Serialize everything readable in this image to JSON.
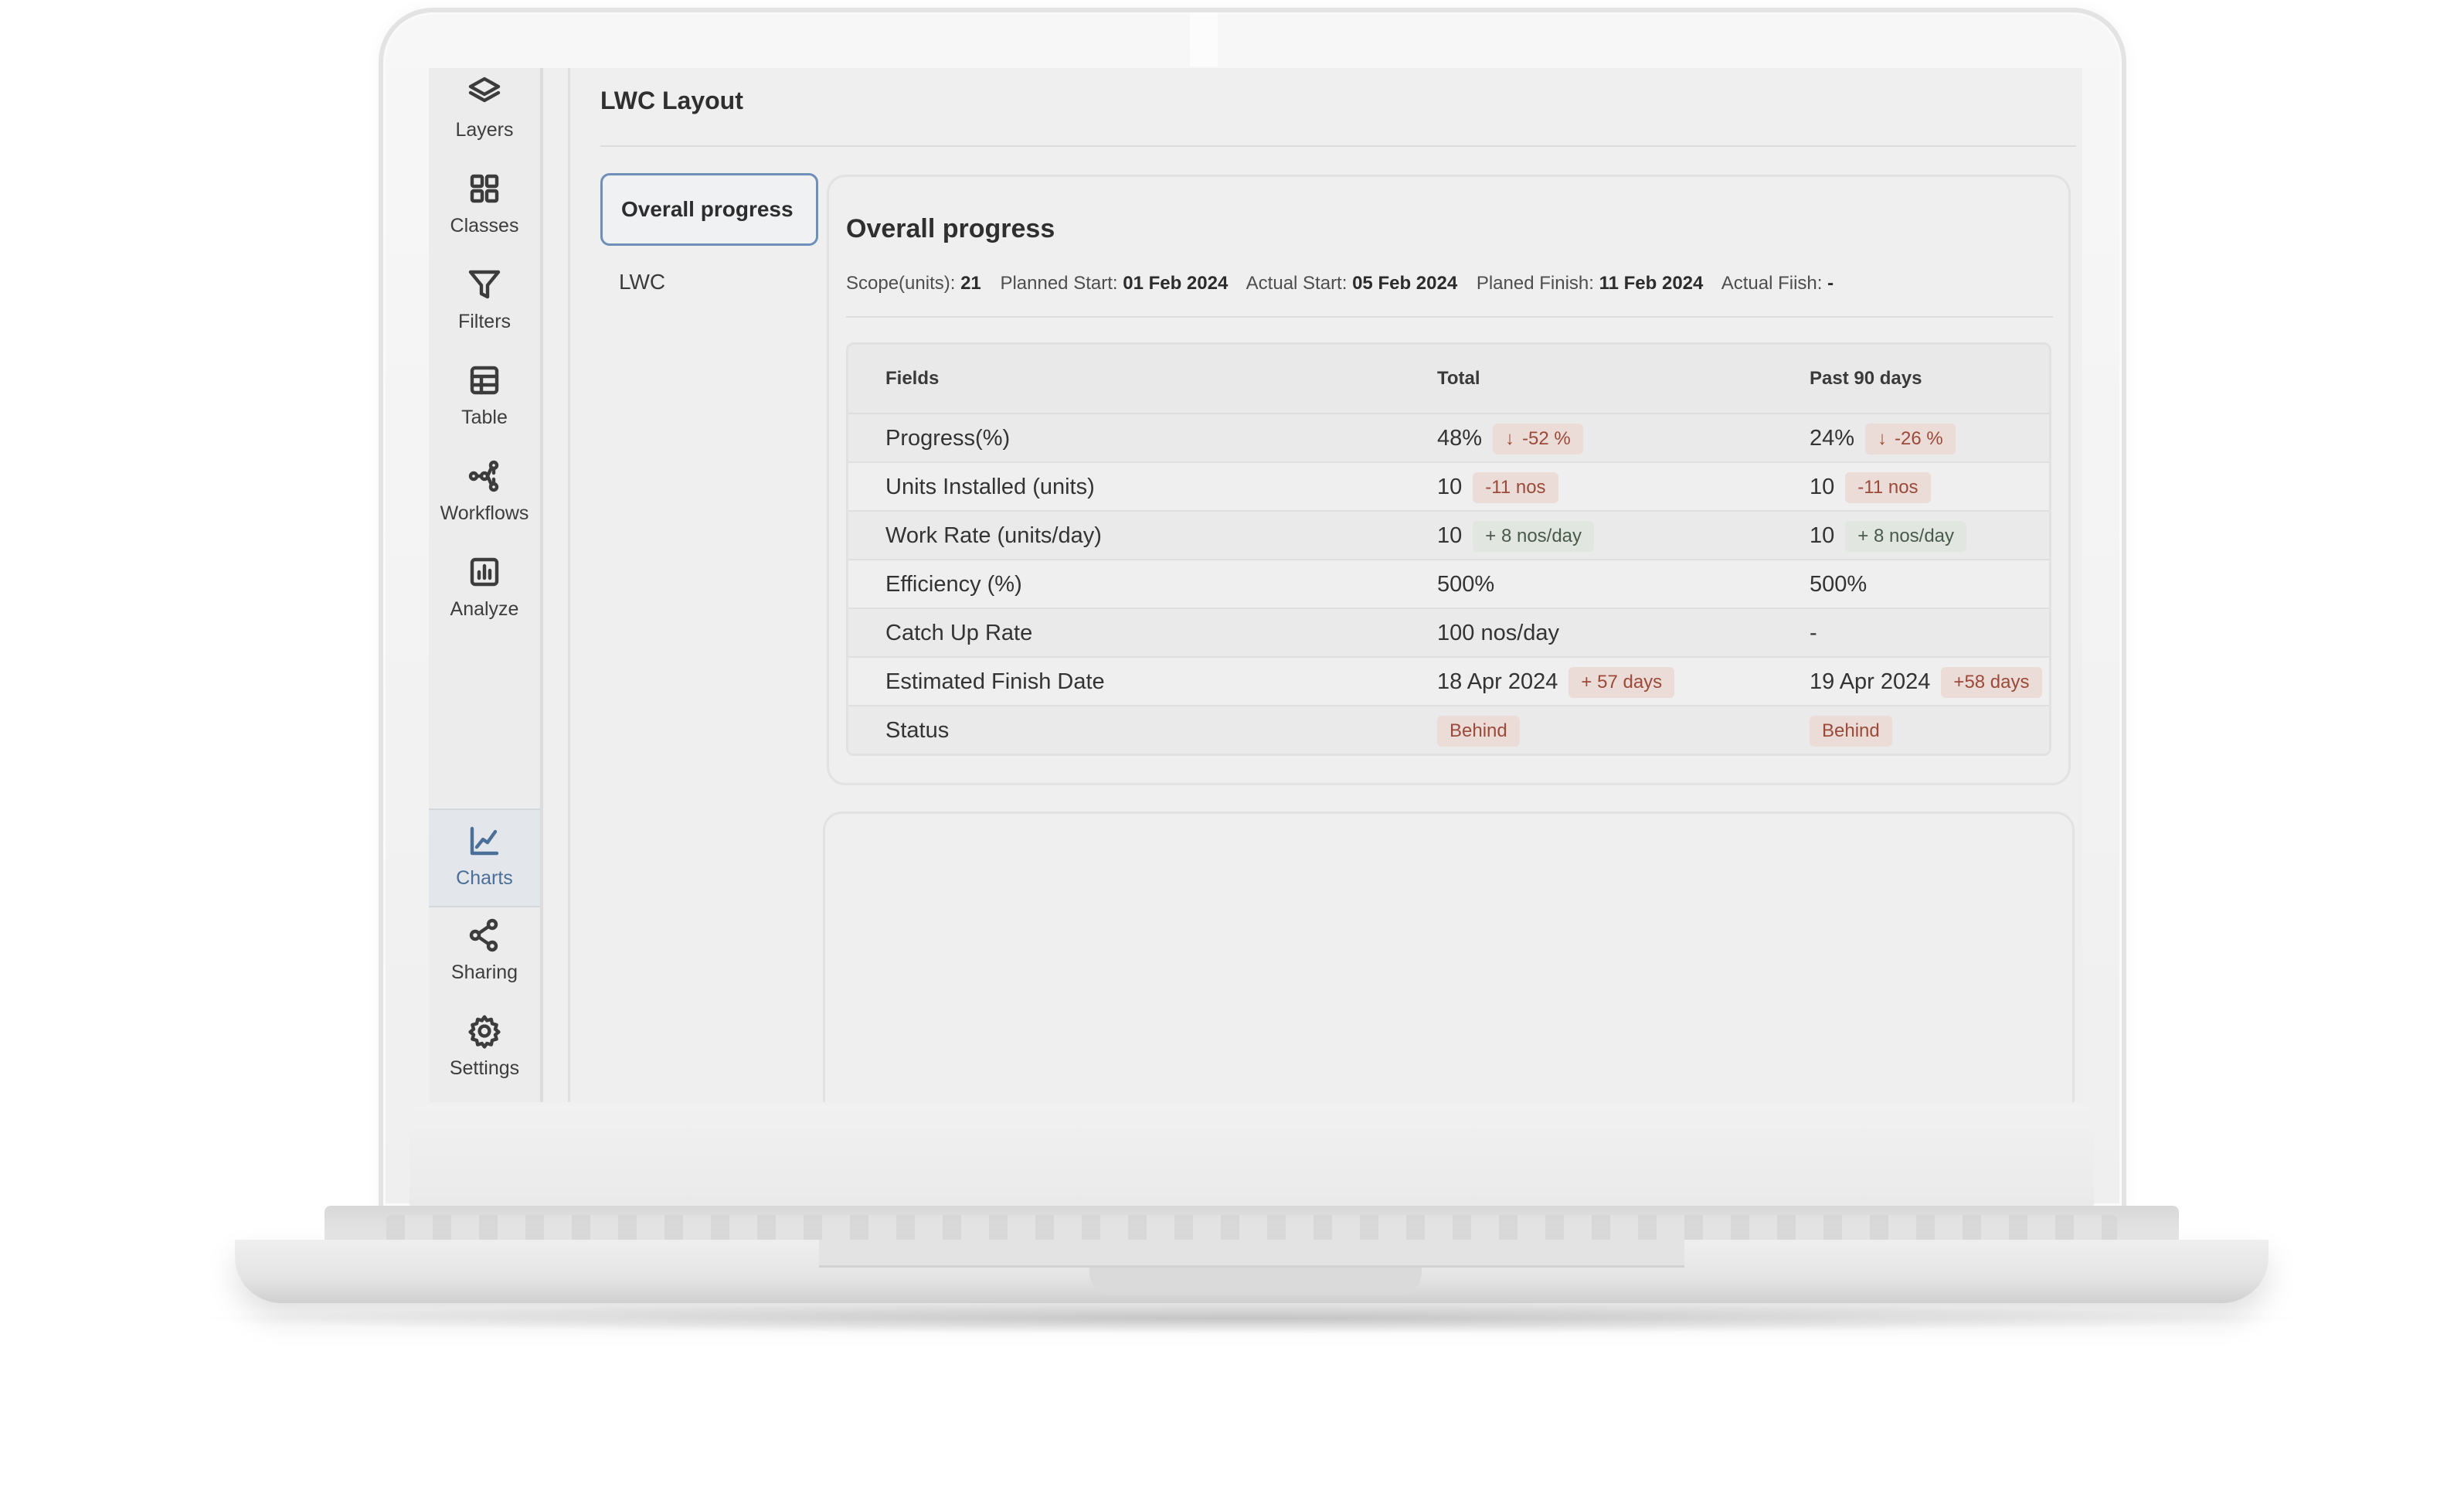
{
  "sidebar": {
    "top_items": [
      {
        "label": "Layers",
        "icon": "layers-icon"
      },
      {
        "label": "Classes",
        "icon": "grid-icon"
      },
      {
        "label": "Filters",
        "icon": "filter-icon"
      },
      {
        "label": "Table",
        "icon": "table-icon"
      },
      {
        "label": "Workflows",
        "icon": "workflow-icon"
      },
      {
        "label": "Analyze",
        "icon": "bar-chart-icon"
      }
    ],
    "bottom_items": [
      {
        "label": "Charts",
        "icon": "line-chart-icon",
        "active": true
      },
      {
        "label": "Sharing",
        "icon": "share-icon"
      },
      {
        "label": "Settings",
        "icon": "gear-icon"
      }
    ]
  },
  "page": {
    "title": "LWC Layout"
  },
  "subnav": {
    "items": [
      {
        "label": "Overall progress",
        "active": true
      },
      {
        "label": "LWC",
        "active": false
      }
    ]
  },
  "overview": {
    "title": "Overall progress",
    "meta": {
      "scope_label": "Scope(units):",
      "scope_value": "21",
      "planned_start_label": "Planned Start:",
      "planned_start_value": "01 Feb 2024",
      "actual_start_label": "Actual Start:",
      "actual_start_value": "05 Feb 2024",
      "planned_finish_label": "Planed Finish:",
      "planned_finish_value": "11 Feb 2024",
      "actual_finish_label": "Actual Fiish:",
      "actual_finish_value": "-"
    },
    "table": {
      "headers": [
        "Fields",
        "Total",
        "Past 90 days"
      ],
      "rows": [
        {
          "field": "Progress(%)",
          "total": "48%",
          "total_badge": "-52 %",
          "past": "24%",
          "past_badge": "-26 %"
        },
        {
          "field": "Units Installed (units)",
          "total": "10",
          "total_badge": "-11 nos",
          "past": "10",
          "past_badge": "-11 nos"
        },
        {
          "field": "Work Rate (units/day)",
          "total": "10",
          "total_badge": "+ 8 nos/day",
          "past": "10",
          "past_badge": "+ 8 nos/day"
        },
        {
          "field": "Efficiency (%)",
          "total": "500%",
          "past": "500%"
        },
        {
          "field": "Catch Up Rate",
          "total": "100 nos/day",
          "past": "-"
        },
        {
          "field": "Estimated Finish Date",
          "total": "18 Apr 2024",
          "total_badge": "+ 57 days",
          "past": "19 Apr 2024",
          "past_badge": "+58 days"
        },
        {
          "field": "Status",
          "total_badge": "Behind",
          "past_badge": "Behind"
        }
      ]
    }
  },
  "colors": {
    "accent": "#4a6f98",
    "negative_badge_bg": "#ecdcd7",
    "negative_badge_text": "#9b4a3a",
    "positive_badge_bg": "#e1e6e1"
  }
}
